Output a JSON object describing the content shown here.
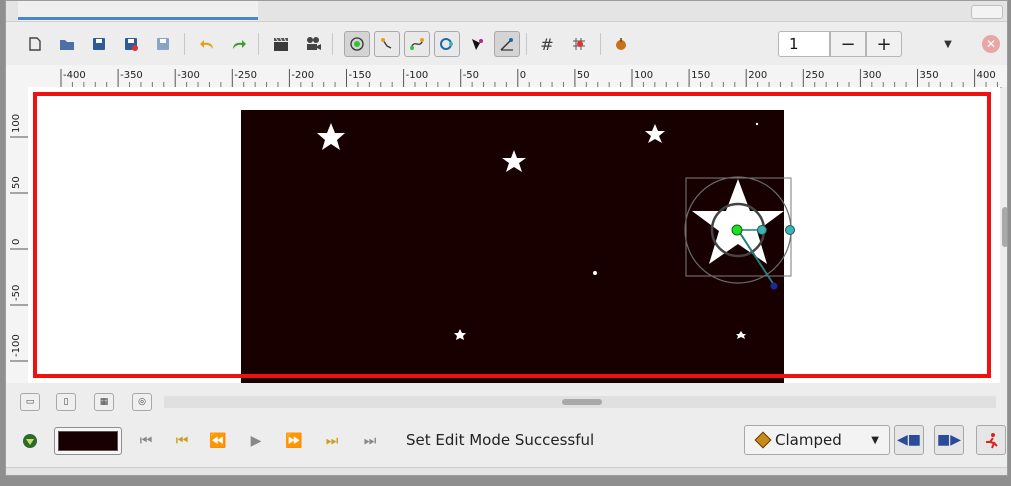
{
  "toolbar": {
    "buttons": [
      {
        "name": "new-file-icon",
        "glyph": "▭"
      },
      {
        "name": "open-file-icon",
        "glyph": "▬"
      },
      {
        "name": "save-icon",
        "glyph": "▣"
      },
      {
        "name": "save-as-icon",
        "glyph": "▣"
      },
      {
        "name": "save-all-icon",
        "glyph": "▣"
      },
      {
        "name": "undo-icon",
        "glyph": "↶"
      },
      {
        "name": "redo-icon",
        "glyph": "↷"
      },
      {
        "name": "render-icon",
        "glyph": "🎬"
      },
      {
        "name": "preview-icon",
        "glyph": "🎥"
      }
    ],
    "zoom_value": "1",
    "zoom_minus": "−",
    "zoom_plus": "+",
    "menu_arrow": "▼",
    "close_glyph": "✕",
    "grid_glyph": "#"
  },
  "ruler": {
    "top_labels": [
      "-400",
      "-350",
      "-300",
      "-250",
      "-200",
      "-150",
      "-100",
      "-50",
      "0",
      "50",
      "100",
      "150",
      "200",
      "250",
      "300",
      "350",
      "400"
    ],
    "left_labels": [
      "100",
      "50",
      "0",
      "-50",
      "-100"
    ]
  },
  "bottom": {
    "status": "Set Edit Mode Successful",
    "interpolation": "Clamped",
    "interpolation_arrow": "▼",
    "transport": [
      "⏮",
      "⏮",
      "⏪",
      "▶",
      "⏩",
      "⏭",
      "⏭"
    ],
    "canvas_bg_color": "#180000",
    "frame_color": "#ef1010"
  }
}
